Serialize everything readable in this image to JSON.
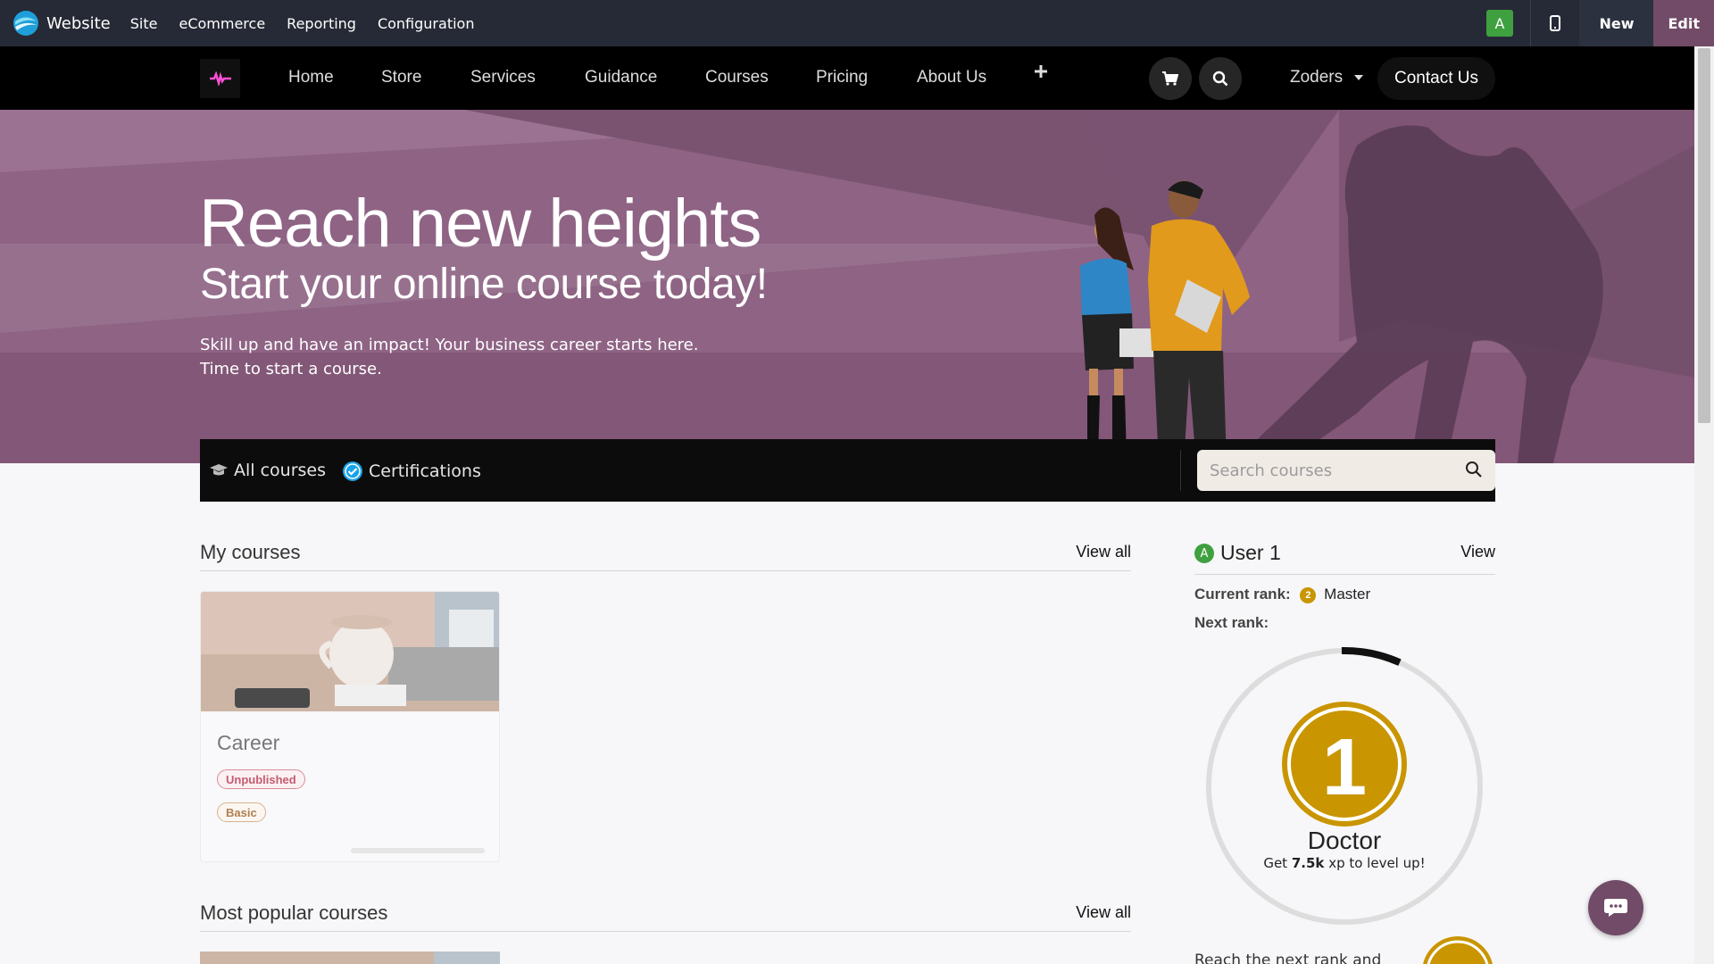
{
  "adminbar": {
    "app_name": "Website",
    "menu": [
      "Site",
      "eCommerce",
      "Reporting",
      "Configuration"
    ],
    "avatar_letter": "A",
    "new_label": "New",
    "edit_label": "Edit"
  },
  "sitenav": {
    "items": [
      "Home",
      "Store",
      "Services",
      "Guidance",
      "Courses",
      "Pricing",
      "About Us"
    ],
    "add_icon": "plus-icon",
    "user": "Zoders",
    "contact": "Contact Us"
  },
  "hero": {
    "title": "Reach new heights",
    "subtitle": "Start your online course today!",
    "text_line1": "Skill up and have an impact! Your business career starts here.",
    "text_line2": "Time to start a course."
  },
  "courses_bar": {
    "all_courses": "All courses",
    "certifications": "Certifications",
    "search_placeholder": "Search courses"
  },
  "my_courses": {
    "title": "My courses",
    "view_all": "View all",
    "cards": [
      {
        "title": "Career",
        "badges": [
          "Unpublished",
          "Basic"
        ]
      }
    ]
  },
  "popular": {
    "title": "Most popular courses",
    "view_all": "View all"
  },
  "user_panel": {
    "avatar_letter": "A",
    "name": "User 1",
    "view": "View",
    "current_rank_label": "Current rank:",
    "current_rank_badge": "2",
    "current_rank": "Master",
    "next_rank_label": "Next rank:",
    "next_rank_number": "1",
    "next_rank_name": "Doctor",
    "hint_prefix": "Get",
    "hint_value": "7.5k",
    "hint_suffix": "xp to level up!",
    "progress_fraction": 0.07,
    "reach_text": "Reach the next rank and"
  },
  "colors": {
    "admin_bg": "#262a36",
    "brand": "#714b67",
    "hero_bg": "#8e6384",
    "gold": "#c99500",
    "green": "#3fa03f"
  }
}
